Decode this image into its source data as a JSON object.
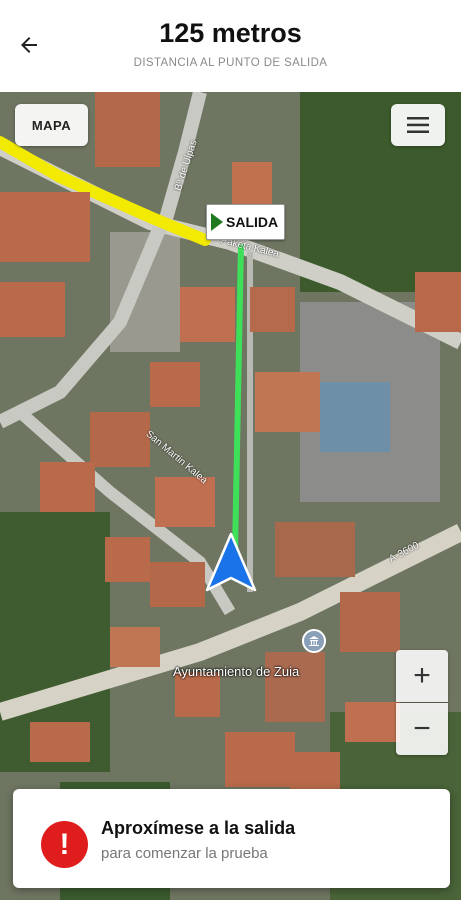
{
  "header": {
    "title": "125 metros",
    "subtitle": "DISTANCIA AL PUNTO DE SALIDA"
  },
  "map": {
    "mapa_button_label": "MAPA",
    "start_marker_label": "SALIDA",
    "poi_label": "Ayuntamiento de Zuia",
    "street_labels": [
      "Paketa Kalea",
      "San Martin Kalea",
      "Bº de Ulpas",
      "A-3600"
    ],
    "zoom_in_label": "+",
    "zoom_out_label": "−",
    "colors": {
      "route_highlight": "#f2ea00",
      "guide_line": "#3ee05a",
      "arrow": "#1a73e8"
    }
  },
  "card": {
    "icon": "exclamation-icon",
    "icon_glyph": "!",
    "title": "Aproxímese a la salida",
    "subtitle": "para comenzar la prueba"
  }
}
